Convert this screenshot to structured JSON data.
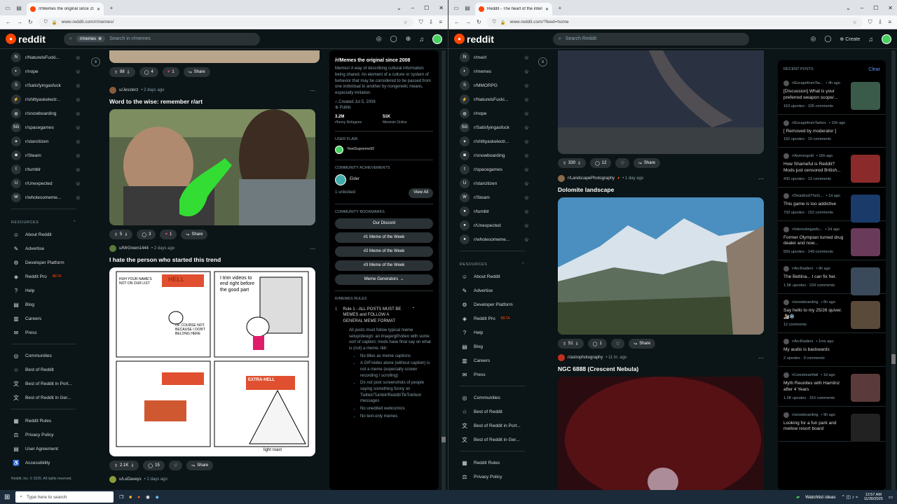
{
  "left": {
    "tab_title": "/r/Memes the original since 20",
    "url": "www.reddit.com/r/memes/",
    "search_chip": "r/memes",
    "search_placeholder": "Search in r/memes",
    "sidebar_subs": [
      "r/NaturelsFucki...",
      "r/nope",
      "r/Satisfyingasfuck",
      "r/shittyaskelectr...",
      "r/snowboarding",
      "r/spacegames",
      "r/starcitizen",
      "r/Steam",
      "r/tumblr",
      "r/Unexpected",
      "r/wholesomeme..."
    ],
    "resources_label": "RESOURCES",
    "resources": [
      "About Reddit",
      "Advertise",
      "Developer Platform",
      "Reddit Pro",
      "Help",
      "Blog",
      "Careers",
      "Press"
    ],
    "beta": "BETA",
    "communities": [
      "Communities",
      "Best of Reddit",
      "Best of Reddit in Port...",
      "Best of Reddit in Ger..."
    ],
    "rules_links": [
      "Reddit Rules",
      "Privacy Policy",
      "User Agreement",
      "Accessibility"
    ],
    "copyright": "Reddit, Inc. © 2025. All rights reserved.",
    "post0": {
      "votes": "88",
      "comments": "4",
      "awards": "1",
      "share": "Share"
    },
    "post1": {
      "user": "u/Jessterz",
      "time": "• 2 days ago",
      "title": "Word to the wise: remember r/art",
      "votes": "5",
      "comments": "3",
      "awards": "1",
      "share": "Share"
    },
    "post2": {
      "user": "u/MrGreen1444",
      "time": "• 2 days ago",
      "title": "I hate the person who started this trend",
      "votes": "2.1K",
      "comments": "15",
      "share": "Share",
      "comic": {
        "p1": "HUH YOUR NAME'S NOT ON OUR LIST",
        "p1b": "OF COURSE NOT. BECAUSE I DON'T BELONG HERE",
        "p2": "I trim videos to end right before the good part",
        "p3": "HELL",
        "p4": "EXTRA-HELL",
        "sig": "light roast"
      }
    },
    "post3": {
      "user": "u/LeDaveys",
      "time": "• 2 days ago"
    },
    "about": {
      "title": "/r/Memes the original since 2008",
      "desc": "Memes! A way of describing cultural information being shared. An element of a culture or system of behavior that may be considered to be passed from one individual to another by nongenetic means, especially imitation.",
      "created": "Created Jul 5, 2008",
      "visibility": "Public",
      "members": "3.2M",
      "members_label": "r/funny Refugees",
      "online": "51K",
      "online_label": "Memists Online"
    },
    "flair_label": "USER FLAIR",
    "flair_user": "YeetSupreme92",
    "ach_label": "COMMUNITY ACHIEVEMENTS",
    "ach_name": "Elder",
    "ach_unlocked": "1 unlocked",
    "view_all": "View All",
    "bookmarks_label": "COMMUNITY BOOKMARKS",
    "bookmarks": [
      "Our Discord",
      "#1 Meme of the Week",
      "#2 Meme of the Week",
      "#3 Meme of the Week",
      "Meme Generators"
    ],
    "rules_label": "R/MEMES RULES",
    "rule1_num": "1",
    "rule1_title": "Rule 1 - ALL POSTS MUST BE MEMES and FOLLOW A GENERAL MEME FORMAT",
    "rule1_body": "All posts must follow typical meme setup/design: an image/gif/video with some sort of caption; mods have final say on what is (not) a meme. tldr:",
    "rule1_bullets": [
      "No titles as meme captions",
      "A GIF/video alone (without caption) is not a meme (especially screen recording / scrolling)",
      "Do not post screenshots of people saying something funny on Twitter/Tumblr/Reddit/TikTok/text messages",
      "No unedited webcomics",
      "No text-only memes"
    ]
  },
  "right": {
    "tab_title": "Reddit - The heart of the intern",
    "url": "www.reddit.com/?feed=home",
    "search_placeholder": "Search Reddit",
    "create": "Create",
    "sidebar_subs": [
      "r/meirl",
      "r/memes",
      "r/MMORPG",
      "r/NaturelsFucki...",
      "r/nope",
      "r/Satisfyingasfuck",
      "r/shittyaskelectr...",
      "r/snowboarding",
      "r/spacegames",
      "r/starcitizen",
      "r/Steam",
      "r/tumblr",
      "r/Unexpected",
      "r/wholesomeme..."
    ],
    "resources_label": "RESOURCES",
    "resources": [
      "About Reddit",
      "Advertise",
      "Developer Platform",
      "Reddit Pro",
      "Help",
      "Blog",
      "Careers",
      "Press"
    ],
    "beta": "BETA",
    "communities": [
      "Communities",
      "Best of Reddit",
      "Best of Reddit in Port...",
      "Best of Reddit in Ger..."
    ],
    "rules_links": [
      "Reddit Rules",
      "Privacy Policy"
    ],
    "post0": {
      "votes": "330",
      "comments": "12",
      "share": "Share"
    },
    "post1": {
      "sub": "r/LandscapePhotography",
      "time": "• 1 day ago",
      "title": "Dolomite landscape",
      "votes": "51",
      "comments": "1",
      "share": "Share"
    },
    "post2": {
      "sub": "r/astrophotography",
      "time": "• 11 hr. ago",
      "title": "NGC 6888 (Crescent Nebula)"
    },
    "recent_label": "RECENT POSTS",
    "clear": "Clear",
    "recent": [
      {
        "sub": "r/EscapefromTar...",
        "time": "• 4h ago",
        "title": "[Discussion] What is your preferred weapon scope/...",
        "stats": "163 upvotes · 105 comments"
      },
      {
        "sub": "r/EscapefromTarkov",
        "time": "• 10h ago",
        "title": "[ Removed by moderator ]",
        "stats": "192 upvotes · 19 comments"
      },
      {
        "sub": "r/Asmongold",
        "time": "• 16h ago",
        "title": "How Shameful is Reddit? Mods just censored British...",
        "stats": "430 upvotes · 13 comments"
      },
      {
        "sub": "r/DeadlockTheG...",
        "time": "• 1d ago",
        "title": "This game is too addictive",
        "stats": "733 upvotes · 152 comments"
      },
      {
        "sub": "r/interestingasfu...",
        "time": "• 2d ago",
        "title": "Former Olympian turned drug dealer and now...",
        "stats": "559 upvotes · 149 comments"
      },
      {
        "sub": "r/ArcRaiders",
        "time": "• 9h ago",
        "title": "The Bettina... I can fix her.",
        "stats": "1.5K upvotes · 234 comments"
      },
      {
        "sub": "r/snowboarding",
        "time": "• 6h ago",
        "title": "Say hello to my 25/26 quiver. 🏂❄️",
        "stats": "12 comments"
      },
      {
        "sub": "r/ArcRaiders",
        "time": "• 1mo ago",
        "title": "My audio is backwards",
        "stats": "2 upvotes · 9 comments"
      },
      {
        "sub": "r/Livestreamfail",
        "time": "• 1d ago",
        "title": "Myth Reunites with Hamlinz after 4 Years",
        "stats": "1.2K upvotes · 315 comments"
      },
      {
        "sub": "r/snowboarding",
        "time": "• 9h ago",
        "title": "Looking for a fun park and mellow resort board",
        "stats": ""
      }
    ]
  },
  "taskbar": {
    "search": "Type here to search",
    "news": "Watchlist ideas",
    "time": "12:57 AM",
    "date": "11/30/2025"
  },
  "colors": {
    "bg": "#0b1416",
    "accent": "#ff4500",
    "pill": "#2a3236"
  }
}
